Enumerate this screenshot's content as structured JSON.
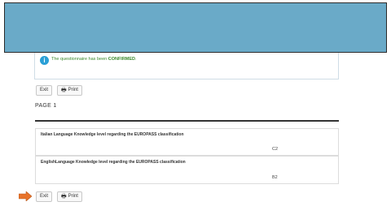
{
  "notice": {
    "text_prefix": "The questionnaire has been ",
    "status": "CONFIRMED",
    "text_suffix": "."
  },
  "buttons": {
    "exit": "Exit",
    "print": "Print"
  },
  "page_title": "PAGE 1",
  "questions": [
    {
      "question": "Italian Language Knowledge level regarding the EUROPASS classification",
      "answer": "C2"
    },
    {
      "question": "EnglishLanguage Knowledge level regarding the EUROPASS classification",
      "answer": "B2"
    }
  ],
  "colors": {
    "header": "#6aaac8",
    "success_text": "#3c8a2e",
    "info_icon": "#2a9fd6",
    "arrow": "#e8732a"
  },
  "icons": [
    "info-icon",
    "printer-icon",
    "arrow-right-icon"
  ]
}
